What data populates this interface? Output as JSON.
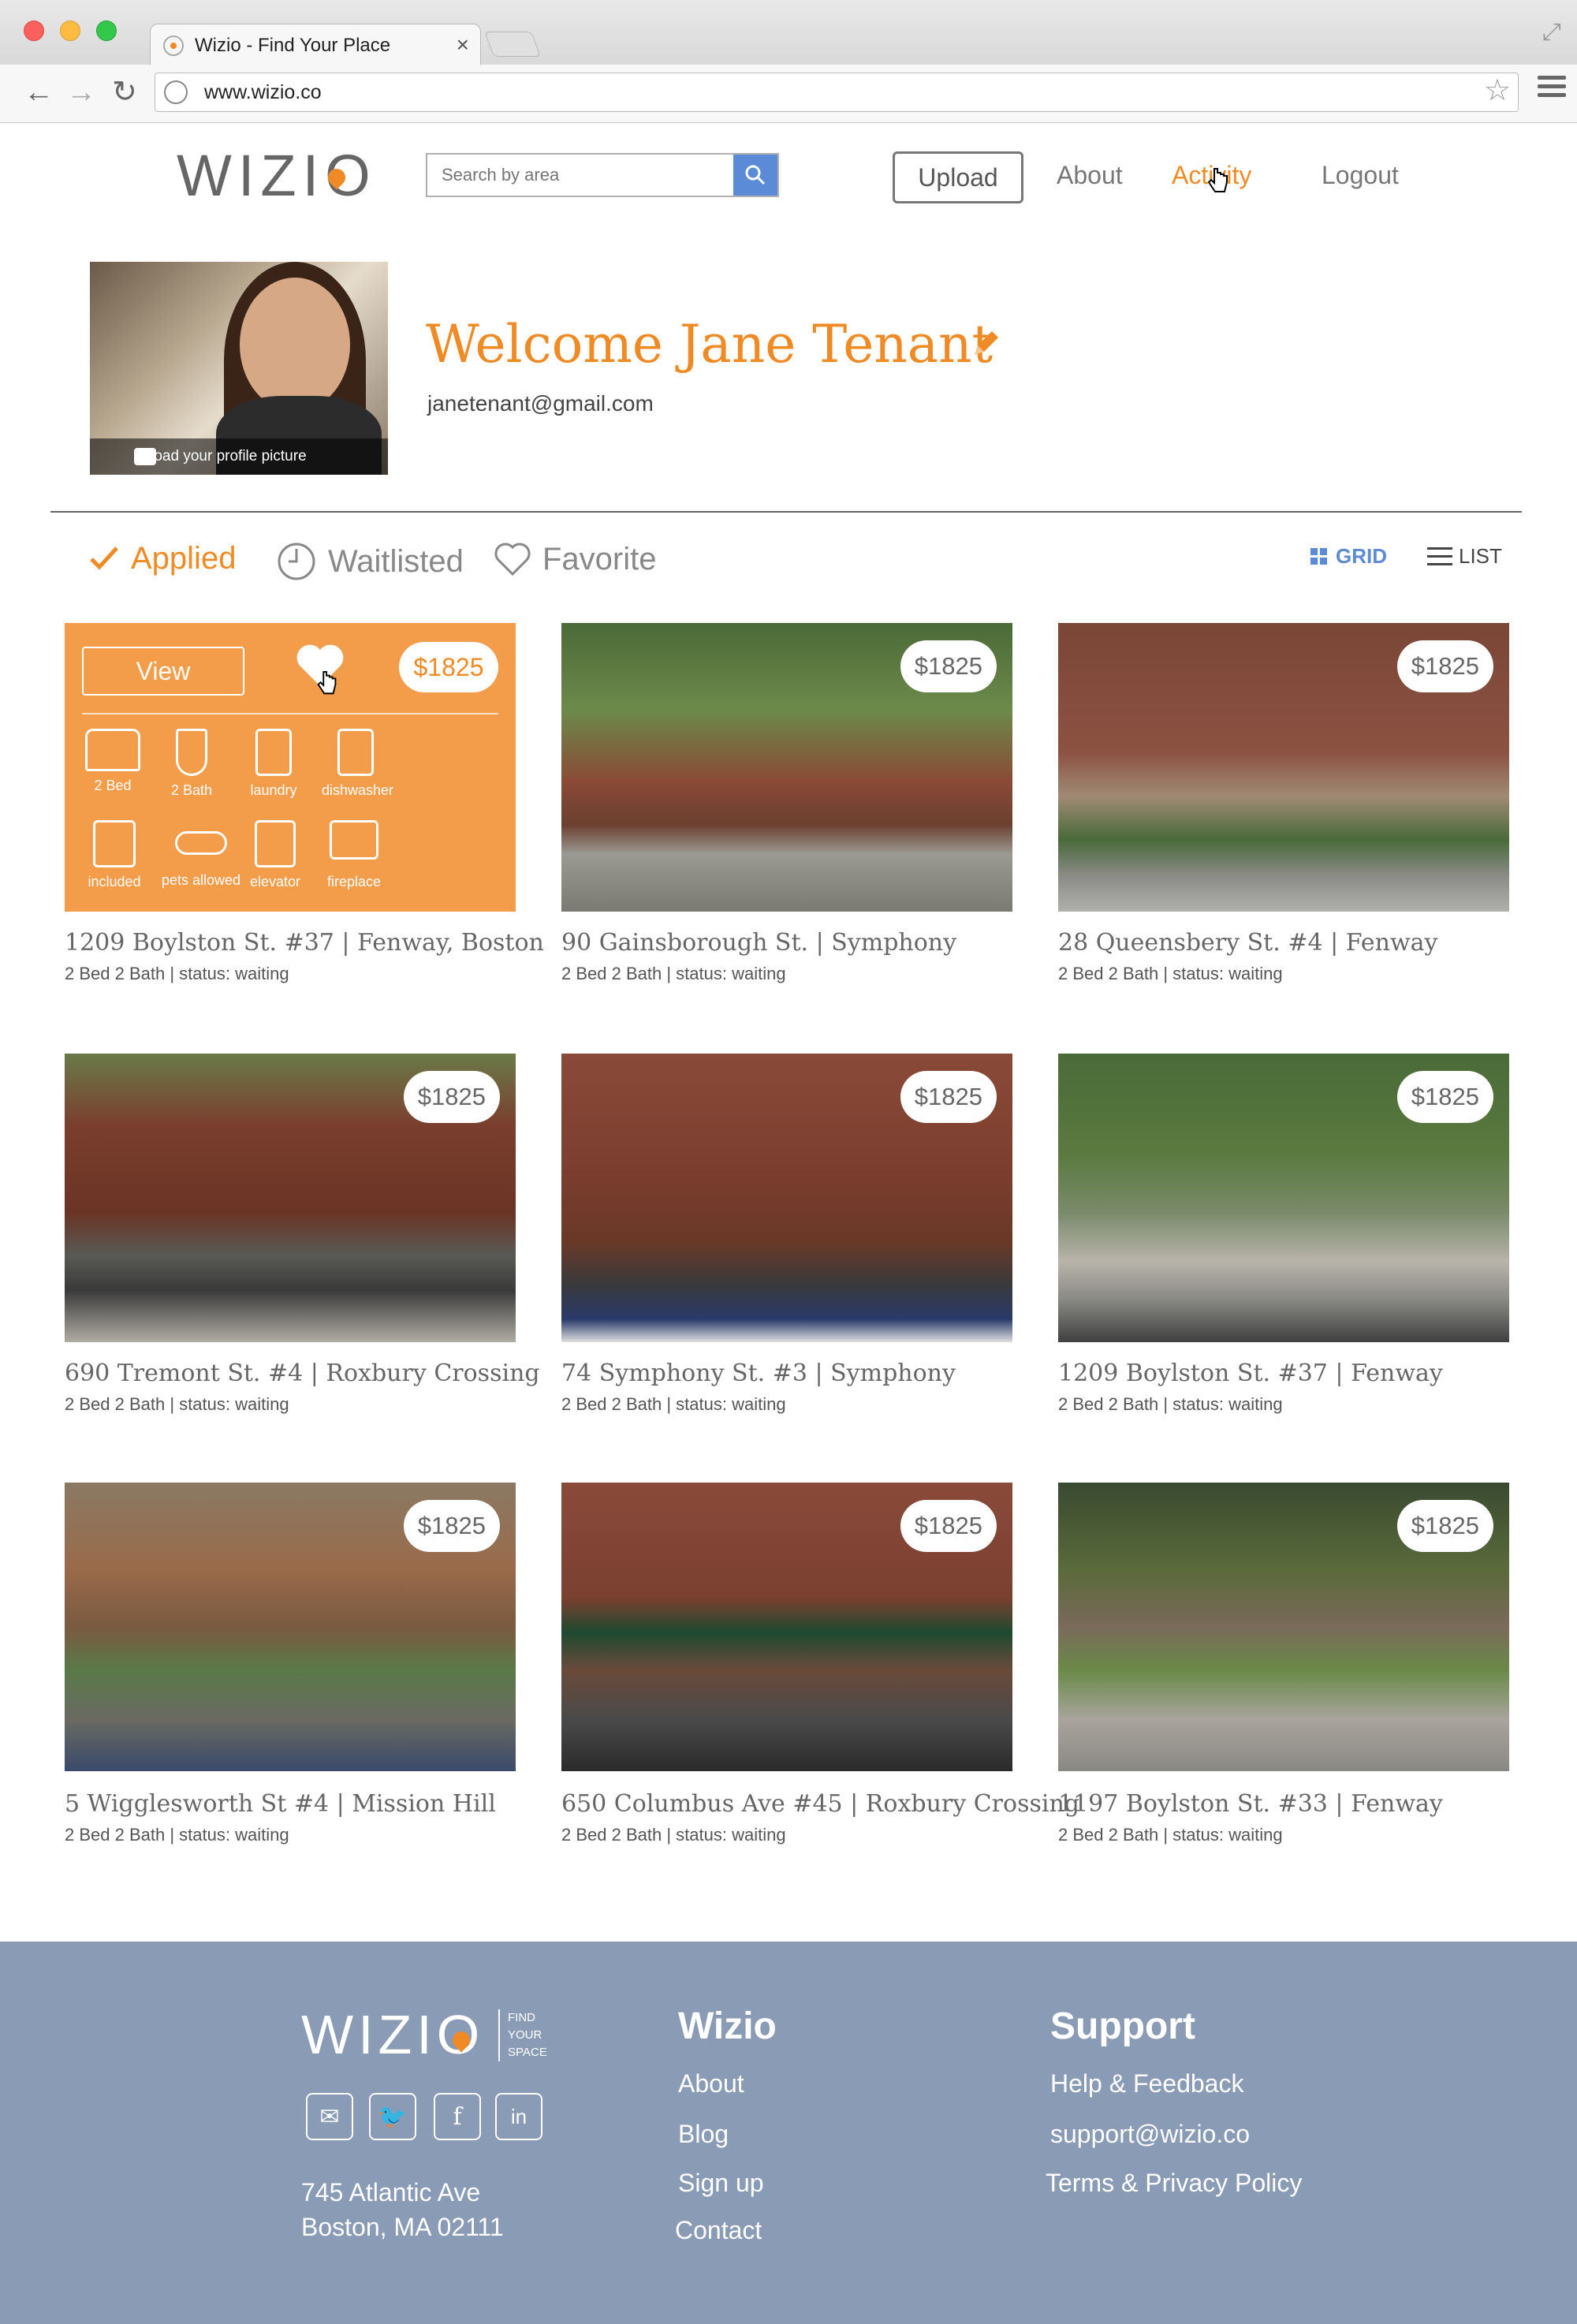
{
  "browser": {
    "tab_title": "Wizio - Find Your Place",
    "url": "www.wizio.co"
  },
  "header": {
    "logo": "WIZIO",
    "search_placeholder": "Search by area",
    "upload_label": "Upload",
    "nav": [
      {
        "label": "About"
      },
      {
        "label": "Activity"
      },
      {
        "label": "Logout"
      }
    ]
  },
  "profile": {
    "upload_caption": "upload your profile picture",
    "welcome": "Welcome Jane Tenant",
    "email": "janetenant@gmail.com"
  },
  "filters": {
    "tabs": [
      {
        "label": "Applied"
      },
      {
        "label": "Waitlisted"
      },
      {
        "label": "Favorite"
      }
    ],
    "grid_label": "GRID",
    "list_label": "LIST"
  },
  "overlay_card": {
    "view_label": "View",
    "price": "$1825",
    "amenities": [
      "2 Bed",
      "2 Bath",
      "laundry",
      "dishwasher",
      "included",
      "pets allowed",
      "elevator",
      "fireplace"
    ]
  },
  "listings": [
    {
      "title": "1209 Boylston St. #37 | Fenway, Boston",
      "details": "2 Bed 2 Bath |  status: waiting",
      "price": "$1825"
    },
    {
      "title": "90 Gainsborough St. | Symphony",
      "details": "2 Bed 2 Bath |  status: waiting",
      "price": "$1825"
    },
    {
      "title": "28 Queensbery St. #4 | Fenway",
      "details": "2 Bed 2 Bath |  status: waiting",
      "price": "$1825"
    },
    {
      "title": "690 Tremont St. #4 | Roxbury Crossing",
      "details": "2 Bed 2 Bath |  status: waiting",
      "price": "$1825"
    },
    {
      "title": "74 Symphony St. #3 | Symphony",
      "details": "2 Bed 2 Bath |  status: waiting",
      "price": "$1825"
    },
    {
      "title": "1209 Boylston St. #37 | Fenway",
      "details": "2 Bed 2 Bath |  status: waiting",
      "price": "$1825"
    },
    {
      "title": "5 Wigglesworth St #4 | Mission Hill",
      "details": "2 Bed 2 Bath |  status: waiting",
      "price": "$1825"
    },
    {
      "title": "650 Columbus Ave #45 | Roxbury Crossing",
      "details": "2 Bed 2 Bath |  status: waiting",
      "price": "$1825"
    },
    {
      "title": "1197 Boylston St. #33 | Fenway",
      "details": "2 Bed 2 Bath |  status: waiting",
      "price": "$1825"
    }
  ],
  "footer": {
    "logo": "WIZIO",
    "tagline": [
      "FIND",
      "YOUR",
      "SPACE"
    ],
    "address_line1": "745 Atlantic Ave",
    "address_line2": "Boston, MA 02111",
    "col1_title": "Wizio",
    "col1_links": [
      "About",
      "Blog",
      "Sign up",
      "Contact"
    ],
    "col2_title": "Support",
    "col2_links": [
      "Help & Feedback",
      "support@wizio.co",
      "Terms & Privacy Policy"
    ]
  },
  "colors": {
    "accent": "#f08a24",
    "footer_bg": "#8a9cb5",
    "search_button": "#5b8bd6",
    "grid_active": "#5b8bd6"
  }
}
